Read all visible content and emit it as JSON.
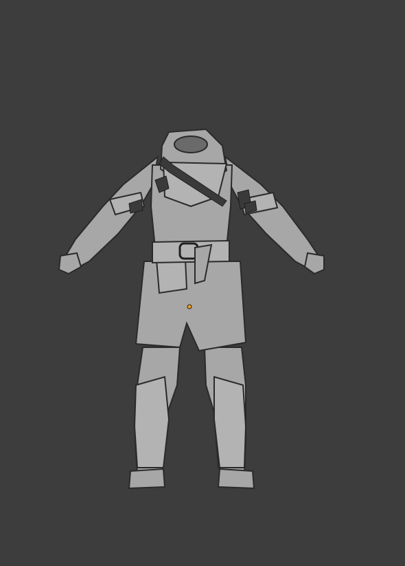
{
  "viewport": {
    "background_color": "#3d3d3d",
    "display_mode": "wireframe-overlay",
    "object": "armor-outfit-mesh",
    "mesh_color": "#a9a9a9",
    "wire_color": "#2b2b2b",
    "origin_marker_color": "#f0a020"
  }
}
